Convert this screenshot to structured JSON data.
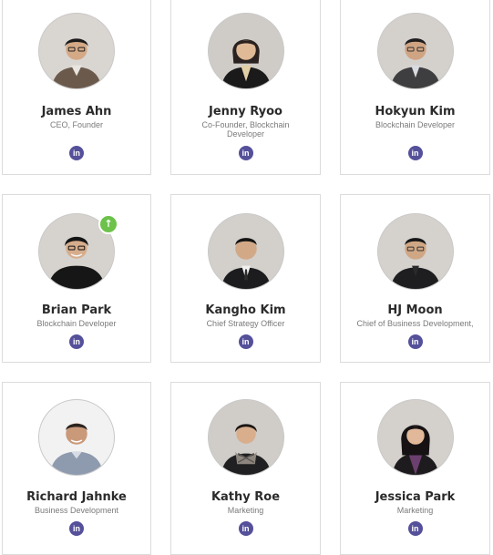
{
  "colors": {
    "linkedin": "#55509a",
    "card_border": "#dcdcdc",
    "badge": "#6cc24a"
  },
  "linkedin_icon": "linkedin-icon",
  "linkedin_text": "in",
  "badge_icon": "arrow-up-icon",
  "badge_text": "↑",
  "team": [
    {
      "name": "James Ahn",
      "role": "CEO, Founder"
    },
    {
      "name": "Jenny Ryoo",
      "role": "Co-Founder, Blockchain Developer"
    },
    {
      "name": "Hokyun Kim",
      "role": "Blockchain Developer"
    },
    {
      "name": "Brian Park",
      "role": "Blockchain Developer"
    },
    {
      "name": "Kangho Kim",
      "role": "Chief Strategy Officer"
    },
    {
      "name": "HJ Moon",
      "role": "Chief of Business Development,"
    },
    {
      "name": "Richard Jahnke",
      "role": "Business Development"
    },
    {
      "name": "Kathy Roe",
      "role": "Marketing"
    },
    {
      "name": "Jessica Park",
      "role": "Marketing"
    }
  ]
}
